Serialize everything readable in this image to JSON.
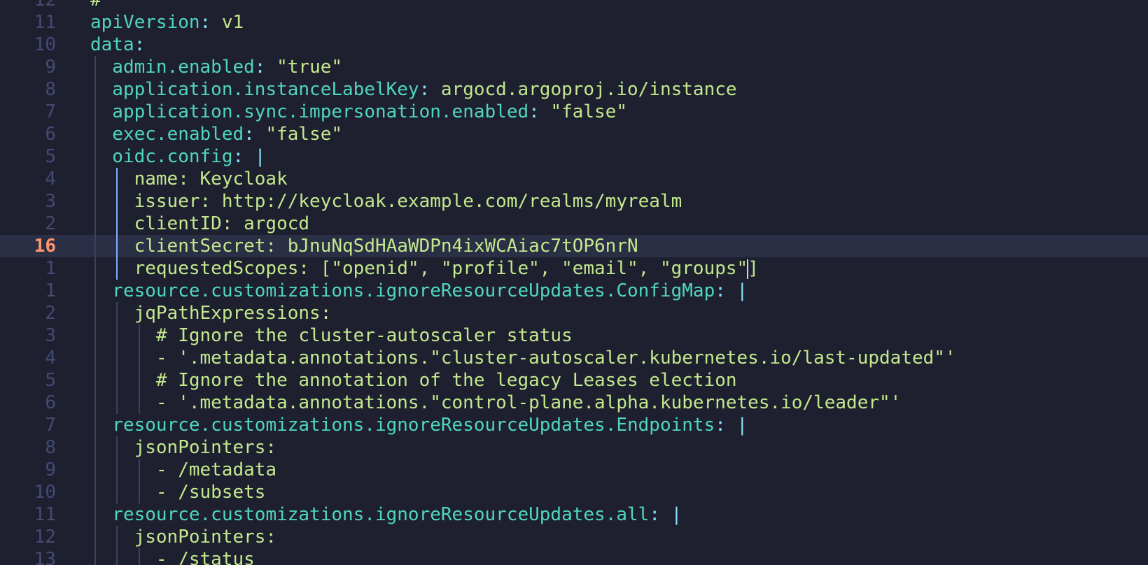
{
  "editor": {
    "current_line_index": 11,
    "lines": [
      {
        "ln": "12",
        "indent": 0,
        "tokens": [
          {
            "t": "#",
            "c": "plain"
          }
        ]
      },
      {
        "ln": "11",
        "indent": 0,
        "tokens": [
          {
            "t": "apiVersion",
            "c": "key"
          },
          {
            "t": ": ",
            "c": "punct"
          },
          {
            "t": "v1",
            "c": "plain"
          }
        ]
      },
      {
        "ln": "10",
        "indent": 0,
        "tokens": [
          {
            "t": "data",
            "c": "key"
          },
          {
            "t": ":",
            "c": "punct"
          }
        ]
      },
      {
        "ln": "9",
        "indent": 1,
        "tokens": [
          {
            "t": "admin.enabled",
            "c": "key"
          },
          {
            "t": ": ",
            "c": "punct"
          },
          {
            "t": "\"true\"",
            "c": "plain"
          }
        ]
      },
      {
        "ln": "8",
        "indent": 1,
        "tokens": [
          {
            "t": "application.instanceLabelKey",
            "c": "key"
          },
          {
            "t": ": ",
            "c": "punct"
          },
          {
            "t": "argocd.argoproj.io/instance",
            "c": "plain"
          }
        ]
      },
      {
        "ln": "7",
        "indent": 1,
        "tokens": [
          {
            "t": "application.sync.impersonation.enabled",
            "c": "key"
          },
          {
            "t": ": ",
            "c": "punct"
          },
          {
            "t": "\"false\"",
            "c": "plain"
          }
        ]
      },
      {
        "ln": "6",
        "indent": 1,
        "tokens": [
          {
            "t": "exec.enabled",
            "c": "key"
          },
          {
            "t": ": ",
            "c": "punct"
          },
          {
            "t": "\"false\"",
            "c": "plain"
          }
        ]
      },
      {
        "ln": "5",
        "indent": 1,
        "tokens": [
          {
            "t": "oidc.config",
            "c": "key"
          },
          {
            "t": ": ",
            "c": "punct"
          },
          {
            "t": "|",
            "c": "punct"
          }
        ]
      },
      {
        "ln": "4",
        "indent": 2,
        "tokens": [
          {
            "t": "name: Keycloak",
            "c": "plain"
          }
        ]
      },
      {
        "ln": "3",
        "indent": 2,
        "tokens": [
          {
            "t": "issuer: http://keycloak.example.com/realms/myrealm",
            "c": "plain"
          }
        ]
      },
      {
        "ln": "2",
        "indent": 2,
        "tokens": [
          {
            "t": "clientID: argocd",
            "c": "plain"
          }
        ]
      },
      {
        "ln": "16",
        "indent": 2,
        "tokens": [
          {
            "t": "clientSecret: bJnuNqSdHAaWDPn4ixWCAiac7tOP6nrN",
            "c": "plain"
          }
        ]
      },
      {
        "ln": "1",
        "indent": 2,
        "tokens": [
          {
            "t": "requestedScopes: [\"openid\", \"profile\", \"email\", \"groups\"",
            "c": "plain"
          },
          {
            "t": "|",
            "c": "cursor"
          },
          {
            "t": "]",
            "c": "plain"
          }
        ]
      },
      {
        "ln": "1",
        "indent": 1,
        "tokens": [
          {
            "t": "resource.customizations.ignoreResourceUpdates.ConfigMap",
            "c": "key"
          },
          {
            "t": ": ",
            "c": "punct"
          },
          {
            "t": "|",
            "c": "punct"
          }
        ]
      },
      {
        "ln": "2",
        "indent": 2,
        "tokens": [
          {
            "t": "jqPathExpressions:",
            "c": "plain"
          }
        ]
      },
      {
        "ln": "3",
        "indent": 3,
        "tokens": [
          {
            "t": "# Ignore the cluster-autoscaler status",
            "c": "comment"
          }
        ]
      },
      {
        "ln": "4",
        "indent": 3,
        "tokens": [
          {
            "t": "- '.metadata.annotations.\"cluster-autoscaler.kubernetes.io/last-updated\"'",
            "c": "plain"
          }
        ]
      },
      {
        "ln": "5",
        "indent": 3,
        "tokens": [
          {
            "t": "# Ignore the annotation of the legacy Leases election",
            "c": "comment"
          }
        ]
      },
      {
        "ln": "6",
        "indent": 3,
        "tokens": [
          {
            "t": "- '.metadata.annotations.\"control-plane.alpha.kubernetes.io/leader\"'",
            "c": "plain"
          }
        ]
      },
      {
        "ln": "7",
        "indent": 1,
        "tokens": [
          {
            "t": "resource.customizations.ignoreResourceUpdates.Endpoints",
            "c": "key"
          },
          {
            "t": ": ",
            "c": "punct"
          },
          {
            "t": "|",
            "c": "punct"
          }
        ]
      },
      {
        "ln": "8",
        "indent": 2,
        "tokens": [
          {
            "t": "jsonPointers:",
            "c": "plain"
          }
        ]
      },
      {
        "ln": "9",
        "indent": 3,
        "tokens": [
          {
            "t": "- /metadata",
            "c": "plain"
          }
        ]
      },
      {
        "ln": "10",
        "indent": 3,
        "tokens": [
          {
            "t": "- /subsets",
            "c": "plain"
          }
        ]
      },
      {
        "ln": "11",
        "indent": 1,
        "tokens": [
          {
            "t": "resource.customizations.ignoreResourceUpdates.all",
            "c": "key"
          },
          {
            "t": ": ",
            "c": "punct"
          },
          {
            "t": "|",
            "c": "punct"
          }
        ]
      },
      {
        "ln": "12",
        "indent": 2,
        "tokens": [
          {
            "t": "jsonPointers:",
            "c": "plain"
          }
        ]
      },
      {
        "ln": "13",
        "indent": 3,
        "tokens": [
          {
            "t": "- /status",
            "c": "plain"
          }
        ]
      }
    ]
  }
}
